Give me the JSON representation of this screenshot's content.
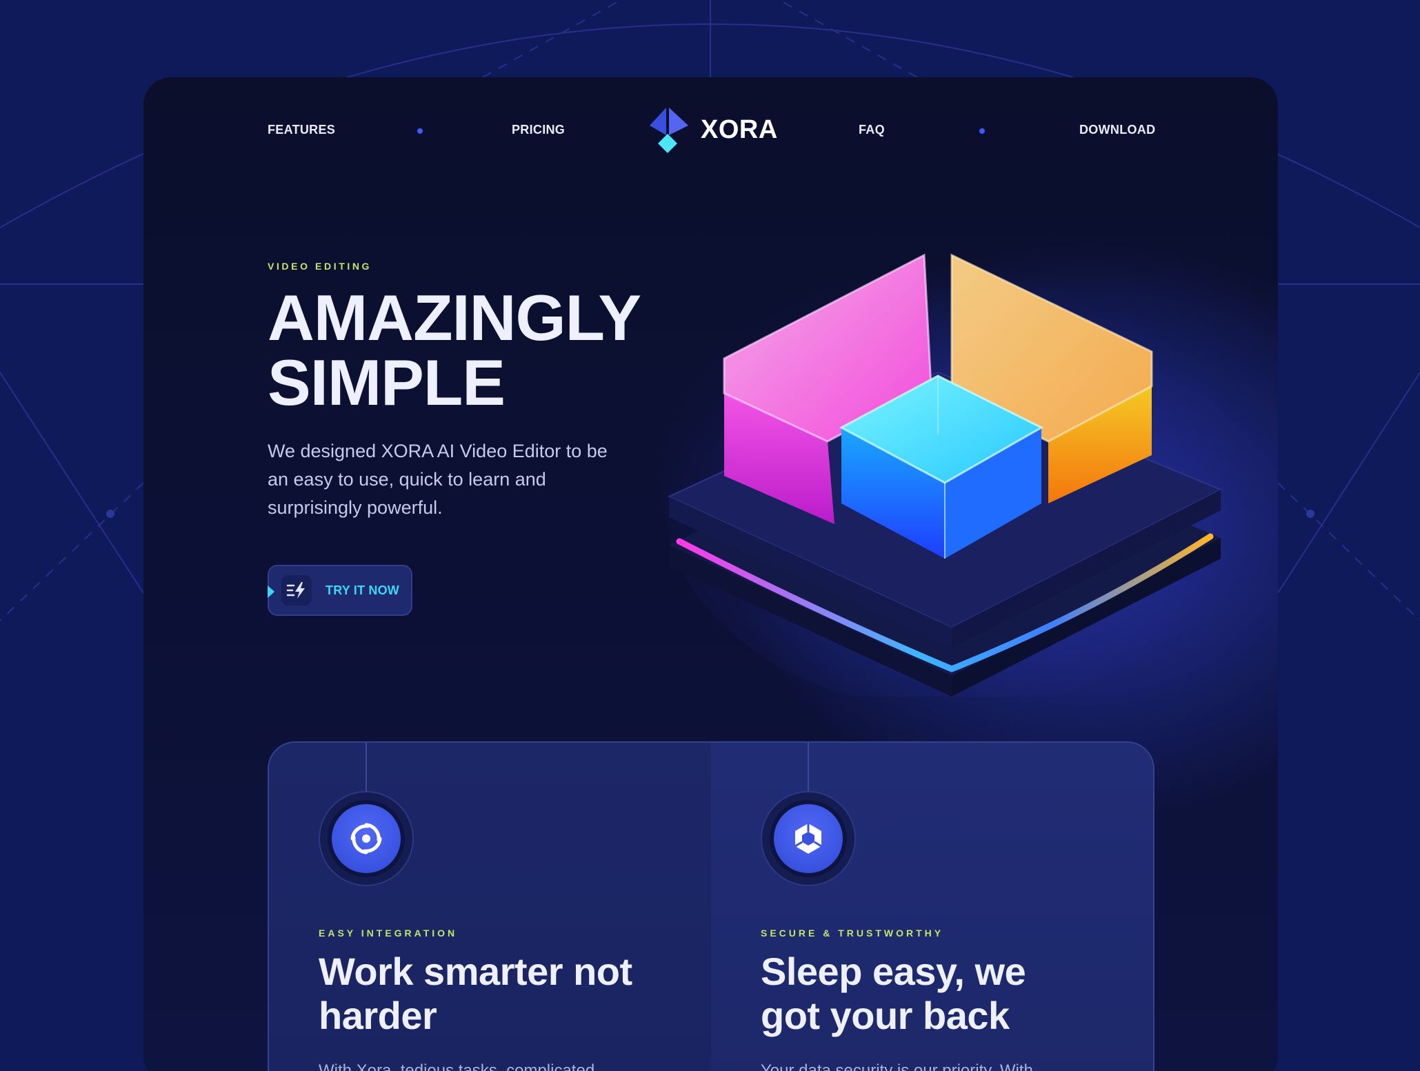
{
  "nav": {
    "features": "FEATURES",
    "pricing": "PRICING",
    "faq": "FAQ",
    "download": "DOWNLOAD",
    "brand": "XORA"
  },
  "hero": {
    "eyebrow": "VIDEO EDITING",
    "title_line1": "AMAZINGLY",
    "title_line2": "SIMPLE",
    "description": "We designed XORA AI Video Editor to be an easy to use, quick to learn and surprisingly powerful.",
    "cta_label": "TRY IT NOW",
    "cta_icon": "lightning-icon"
  },
  "cards": [
    {
      "icon": "swirl-icon",
      "eyebrow": "EASY INTEGRATION",
      "title": "Work smarter not harder",
      "body": "With Xora, tedious tasks, complicated"
    },
    {
      "icon": "hexagon-ring-icon",
      "eyebrow": "SECURE & TRUSTWORTHY",
      "title": "Sleep easy, we got your back",
      "body": "Your data security is our priority. With"
    }
  ],
  "colors": {
    "page_bg": "#0f1a5a",
    "accent_lime": "#c4e667",
    "accent_cyan": "#3fd6f5",
    "accent_blue": "#3b5bff"
  }
}
